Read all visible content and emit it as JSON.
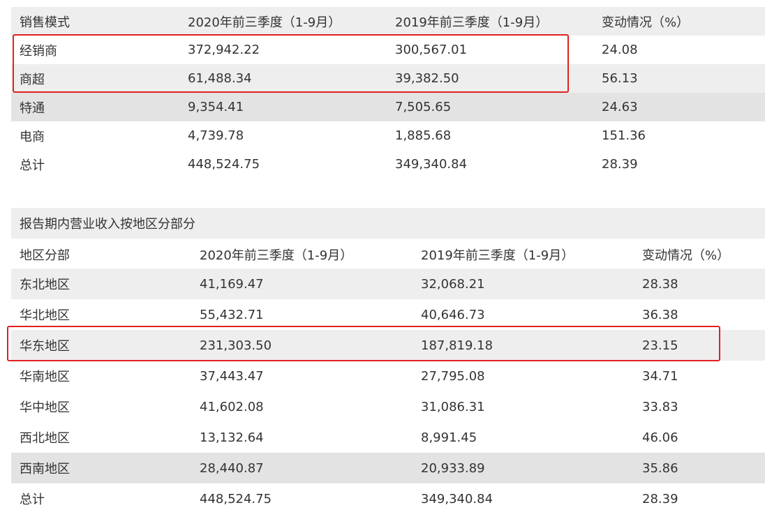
{
  "sales_mode_table": {
    "headers": [
      "销售模式",
      "2020年前三季度（1-9月）",
      "2019年前三季度（1-9月）",
      "变动情况（%）"
    ],
    "rows": [
      [
        "经销商",
        "372,942.22",
        "300,567.01",
        "24.08"
      ],
      [
        "商超",
        "61,488.34",
        "39,382.50",
        "56.13"
      ],
      [
        "特通",
        "9,354.41",
        "7,505.65",
        "24.63"
      ],
      [
        "电商",
        "4,739.78",
        "1,885.68",
        "151.36"
      ],
      [
        "总计",
        "448,524.75",
        "349,340.84",
        "28.39"
      ]
    ]
  },
  "region_section": {
    "caption": "报告期内营业收入按地区分部分"
  },
  "region_table": {
    "headers": [
      "地区分部",
      "2020年前三季度（1-9月）",
      "2019年前三季度（1-9月）",
      "变动情况（%）"
    ],
    "rows": [
      [
        "东北地区",
        "41,169.47",
        "32,068.21",
        "28.38"
      ],
      [
        "华北地区",
        "55,432.71",
        "40,646.73",
        "36.38"
      ],
      [
        "华东地区",
        "231,303.50",
        "187,819.18",
        "23.15"
      ],
      [
        "华南地区",
        "37,443.47",
        "27,795.08",
        "34.71"
      ],
      [
        "华中地区",
        "41,602.08",
        "31,086.31",
        "33.83"
      ],
      [
        "西北地区",
        "13,132.64",
        "8,991.45",
        "46.06"
      ],
      [
        "西南地区",
        "28,440.87",
        "20,933.89",
        "35.86"
      ],
      [
        "总计",
        "448,524.75",
        "349,340.84",
        "28.39"
      ]
    ]
  },
  "highlight_color": "#e02020"
}
